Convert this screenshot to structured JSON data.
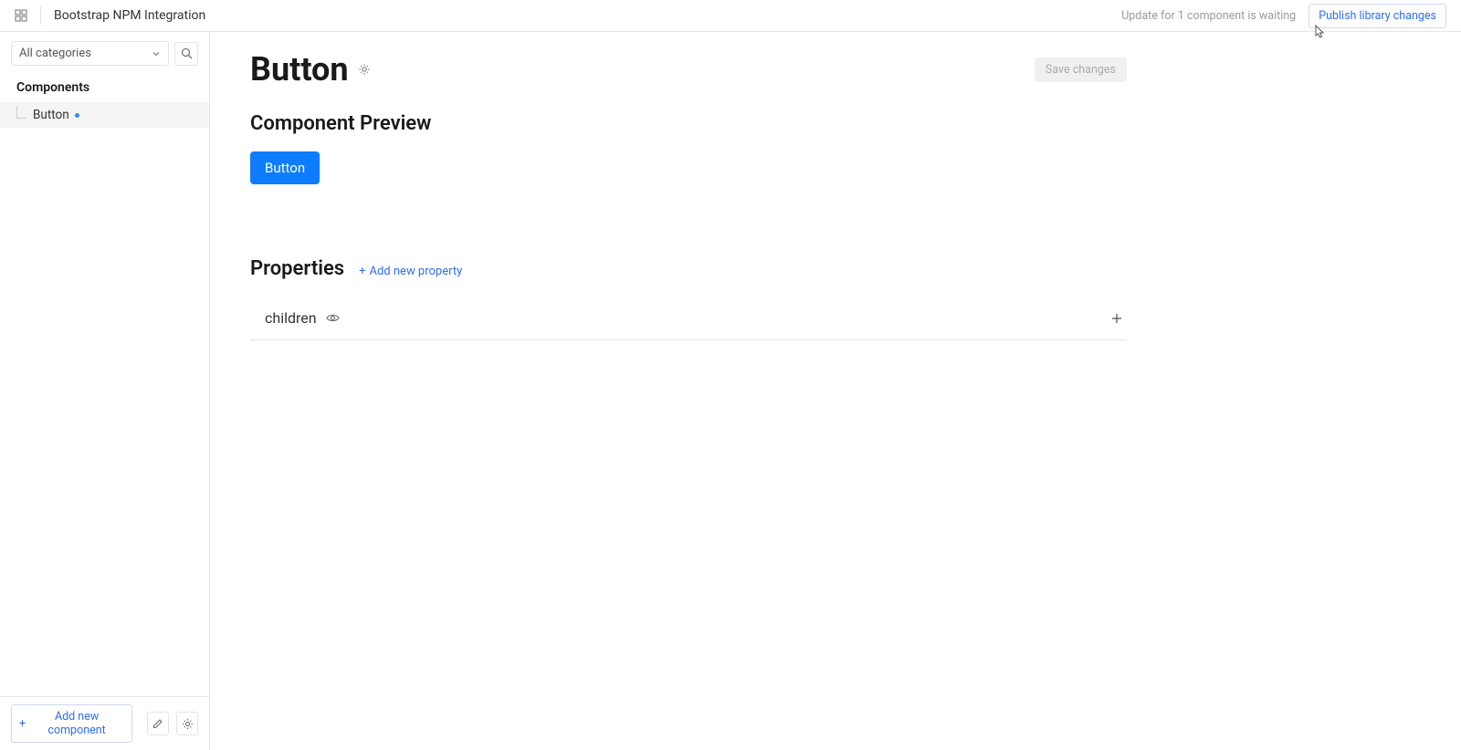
{
  "header": {
    "title": "Bootstrap NPM Integration",
    "update_text": "Update for 1 component is waiting",
    "publish_label": "Publish library changes"
  },
  "sidebar": {
    "category_selector": "All categories",
    "section_title": "Components",
    "items": [
      {
        "label": "Button",
        "modified": true
      }
    ],
    "add_component_label": "Add new component"
  },
  "main": {
    "page_title": "Button",
    "save_label": "Save changes",
    "preview_title": "Component Preview",
    "preview_button_label": "Button",
    "properties_title": "Properties",
    "add_property_label": "Add new property",
    "properties": [
      {
        "name": "children"
      }
    ]
  }
}
